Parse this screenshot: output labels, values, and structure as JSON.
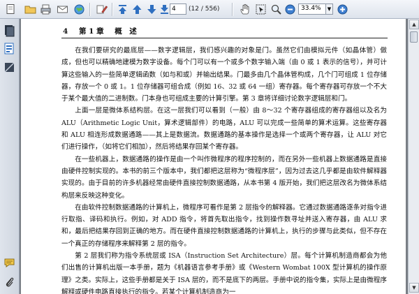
{
  "toolbar": {
    "page_value": "4",
    "page_count": "(12 / 556)",
    "zoom_value": "33.4%"
  },
  "page": {
    "header_number": "4",
    "header_chapter": "第 1 章",
    "header_title": "概　述",
    "paragraphs": [
      "在我们要研究的最底层——数字逻辑层，我们感兴趣的对象是门。虽然它们由模拟元件（如晶体管）做成，但也可以精确地建模为数字设备。每个门可以有一个或多个数字输入端（由 0 或 1 表示的信号），并可计算这些输入的一些简单逻辑函数（如与和或）并输出结果。门最多由几个晶体管构成，几个门可组成 1 位存储器，存放一个 0 或 1。1 位存储器可组合成（例如 16、32 或 64 一组）寄存器。每个寄存器可存放一个不大于某个最大值的二进制数。门本身也可组成主要的计算引擎。第 3 章将详细讨论数字逻辑层和门。",
      "上面一层是微体系结构层。在这一层我们可以看到（一般）由 8～32 个寄存器组成的寄存器组以及名为 ALU（Arithmetic Logic Unit，算术逻辑部件）的电路，ALU 可以完成一些简单的算术运算。这些寄存器和 ALU 相连形成数据通路——其上是数据流。数据通路的基本操作是选择一个或两个寄存器，让 ALU 对它们进行操作，（如将它们相加），然后将结果存回某个寄存器。",
      "在一些机器上，数据通路的操作是由一个叫作微程序的程序控制的，而在另外一些机器上数据通路是直接由硬件控制实现的。本书的前三个版本中，我们都把这层称为“微程序层”，因为过去这几乎都是由软件解释器实现的。由于目前的许多机器经常由硬件直接控制数据通路，从本书第 4 版开始，我们把这层改名为微体系结构层来反映这种变化。",
      "在由软件控制数据通路的计算机上，微程序可看作是第 2 层指令的解释器。它通过数据通路逐条对指令进行取指、译码和执行。例如，对 ADD 指令，将首先取出指令，找到操作数寻址并送入寄存器，由 ALU 求和，最后把结果存回到正确的地方。而在硬件直接控制数据通路的计算机上，执行的步骤与此类似，但不存在一个真正的存储程序来解释第 2 层的指令。",
      "第 2 层我们称为指令系统层或 ISA（Instruction Set Architecture）层。每个计算机制造商都会为他们出售的计算机出版一本手册，题为《机器语言参考手册》或《Western Wombat 100X 型计算机的操作原理》之类。实际上，这些手册都是关于 ISA 层的，而不是底下的两层。手册中说的指令集，实际上是由微程序解释或硬件电路直接执行的指令。若某个计算机制造商为一"
    ]
  },
  "icons": {
    "toolbar": [
      "open-folder-icon",
      "print-icon",
      "save-icon",
      "email-icon",
      "globe-icon",
      "edit-icon",
      "first-page-icon",
      "previous-page-icon",
      "next-page-icon",
      "last-page-icon",
      "hand-tool-icon",
      "select-tool-icon",
      "zoom-tool-icon",
      "zoom-out-icon",
      "zoom-in-icon"
    ],
    "nav": [
      "pages-icon",
      "bookmarks-icon",
      "attachments-icon",
      "comments-icon",
      "paperclip-icon"
    ]
  },
  "colors": {
    "toolbar_bg": "#dde3ec",
    "doc_bg": "#7a7f86",
    "nav_accent": "#2f6fc0"
  }
}
